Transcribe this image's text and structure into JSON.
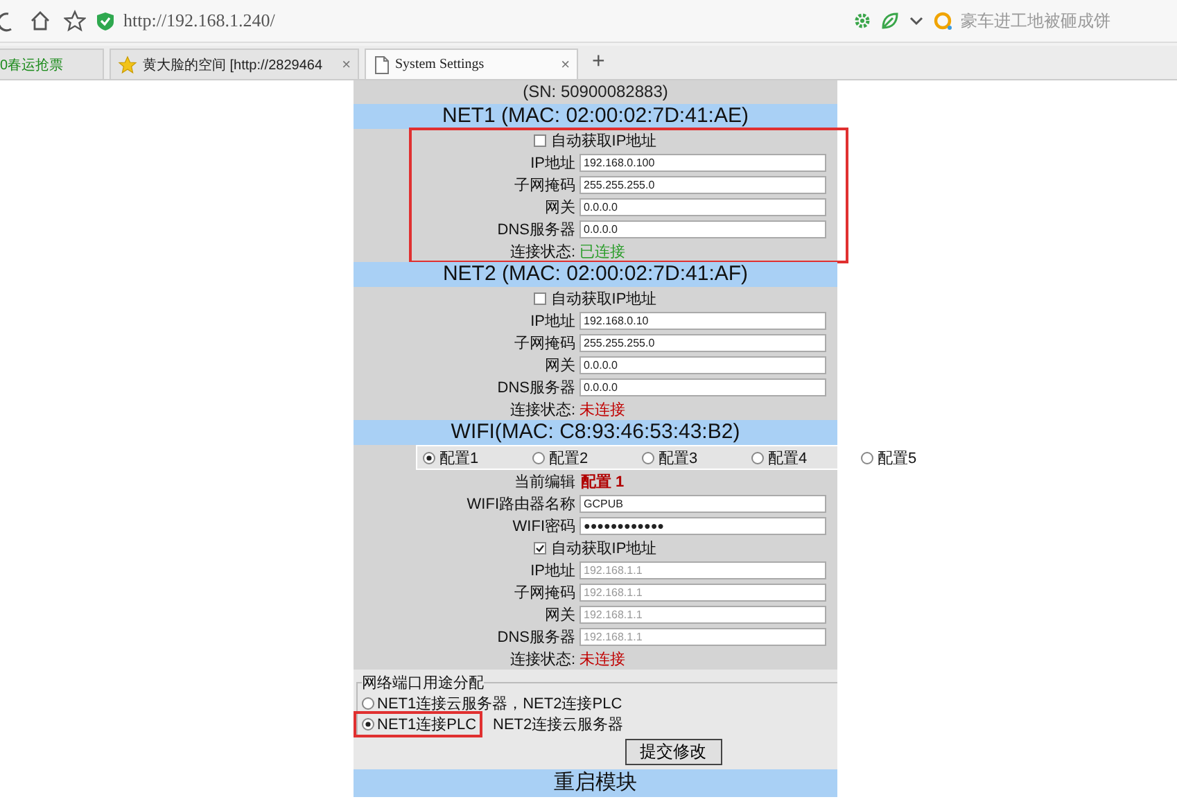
{
  "browser": {
    "address": "http://192.168.1.240/",
    "search_text": "豪车进工地被砸成饼",
    "tabs": [
      {
        "label": "0春运抢票",
        "selected": false
      },
      {
        "label": "黄大脸的空间 [http://2829464",
        "close": "×",
        "selected": false
      },
      {
        "label": "System Settings",
        "close": "×",
        "selected": true
      }
    ],
    "new_tab": "+"
  },
  "page": {
    "serial": "(SN: 50900082883)",
    "sections": [
      {
        "kind": "ethernet",
        "title": "NET1 (MAC: 02:00:02:7D:41:AE)",
        "highlighted": true,
        "auto_ip": {
          "label": "自动获取IP地址",
          "checked": false
        },
        "fields": [
          {
            "label": "IP地址",
            "value": "192.168.0.100",
            "disabled": false
          },
          {
            "label": "子网掩码",
            "value": "255.255.255.0",
            "disabled": false
          },
          {
            "label": "网关",
            "value": "0.0.0.0",
            "disabled": false
          },
          {
            "label": "DNS服务器",
            "value": "0.0.0.0",
            "disabled": false
          }
        ],
        "status": {
          "label": "连接状态:",
          "value": "已连接",
          "connected": true
        }
      },
      {
        "kind": "ethernet",
        "title": "NET2 (MAC: 02:00:02:7D:41:AF)",
        "highlighted": false,
        "auto_ip": {
          "label": "自动获取IP地址",
          "checked": false
        },
        "fields": [
          {
            "label": "IP地址",
            "value": "192.168.0.10",
            "disabled": false
          },
          {
            "label": "子网掩码",
            "value": "255.255.255.0",
            "disabled": false
          },
          {
            "label": "网关",
            "value": "0.0.0.0",
            "disabled": false
          },
          {
            "label": "DNS服务器",
            "value": "0.0.0.0",
            "disabled": false
          }
        ],
        "status": {
          "label": "连接状态:",
          "value": "未连接",
          "connected": false
        }
      },
      {
        "kind": "wifi",
        "title": "WIFI(MAC: C8:93:46:53:43:B2)",
        "highlighted": false,
        "profiles": [
          {
            "label": "配置1",
            "selected": true
          },
          {
            "label": "配置2",
            "selected": false
          },
          {
            "label": "配置3",
            "selected": false
          },
          {
            "label": "配置4",
            "selected": false
          },
          {
            "label": "配置5",
            "selected": false
          }
        ],
        "current_edit": {
          "label": "当前编辑",
          "value": "配置 1"
        },
        "credentials": [
          {
            "label": "WIFI路由器名称",
            "value": "GCPUB",
            "disabled": false
          },
          {
            "label": "WIFI密码",
            "value": "●●●●●●●●●●●●",
            "disabled": false
          }
        ],
        "auto_ip": {
          "label": "自动获取IP地址",
          "checked": true
        },
        "fields": [
          {
            "label": "IP地址",
            "value": "192.168.1.1",
            "disabled": true
          },
          {
            "label": "子网掩码",
            "value": "192.168.1.1",
            "disabled": true
          },
          {
            "label": "网关",
            "value": "192.168.1.1",
            "disabled": true
          },
          {
            "label": "DNS服务器",
            "value": "192.168.1.1",
            "disabled": true
          }
        ],
        "status": {
          "label": "连接状态:",
          "value": "未连接",
          "connected": false
        }
      }
    ],
    "port_assignment": {
      "legend": "网络端口用途分配",
      "options": [
        {
          "label": "NET1连接云服务器，NET2连接PLC",
          "selected": false,
          "highlighted": false
        },
        {
          "label": "NET1连接PLC",
          "note": "NET2连接云服务器",
          "selected": true,
          "highlighted": true
        }
      ]
    },
    "submit": "提交修改",
    "restart_title": "重启模块"
  }
}
